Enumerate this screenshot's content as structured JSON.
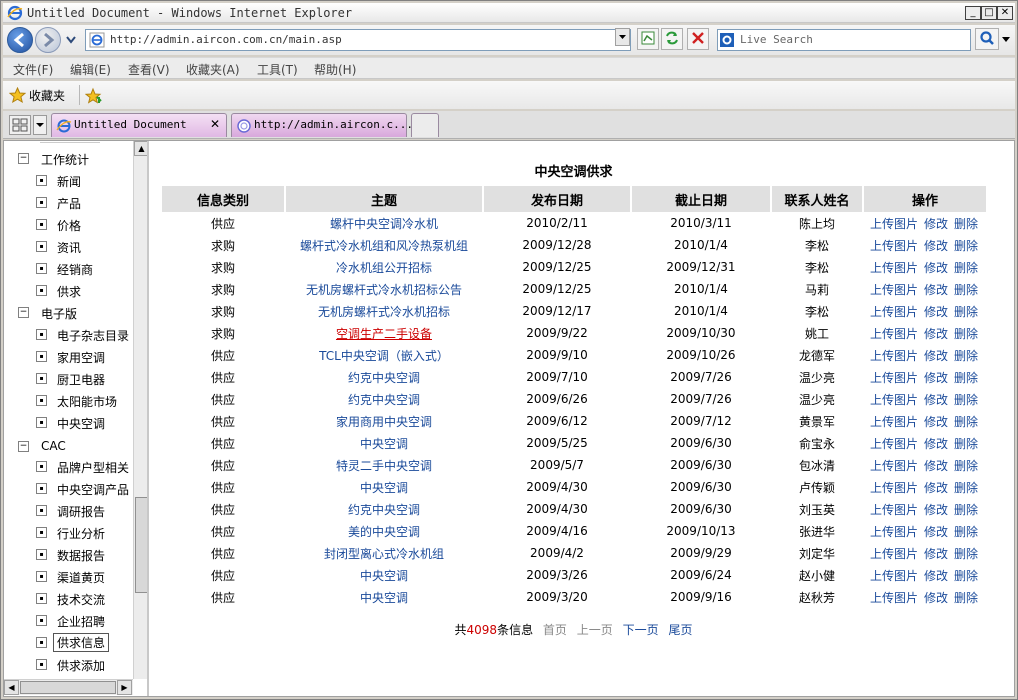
{
  "window": {
    "title": "Untitled Document - Windows Internet Explorer",
    "minimize": "_",
    "maximize": "□",
    "close": "✕"
  },
  "address": {
    "url": "http://admin.aircon.com.cn/main.asp",
    "search_placeholder": "Live Search"
  },
  "menu": [
    "文件(F)",
    "编辑(E)",
    "查看(V)",
    "收藏夹(A)",
    "工具(T)",
    "帮助(H)"
  ],
  "favorites": {
    "label": "收藏夹"
  },
  "tabs": [
    {
      "label": "Untitled Document",
      "close": "✕"
    },
    {
      "label": "http://admin.aircon.c..."
    }
  ],
  "sidebar": {
    "groups": [
      {
        "label": "工作统计",
        "expander": "−",
        "items": [
          "新闻",
          "产品",
          "价格",
          "资讯",
          "经销商",
          "供求"
        ]
      },
      {
        "label": "电子版",
        "expander": "−",
        "items": [
          "电子杂志目录",
          "家用空调",
          "厨卫电器",
          "太阳能市场",
          "中央空调"
        ]
      },
      {
        "label": "CAC",
        "expander": "−",
        "items": [
          "品牌户型相关",
          "中央空调产品",
          "调研报告",
          "行业分析",
          "数据报告",
          "渠道黄页",
          "技术交流",
          "企业招聘",
          "供求信息",
          "供求添加"
        ]
      }
    ],
    "selected": "供求信息"
  },
  "main": {
    "title": "中央空调供求",
    "headers": [
      "信息类别",
      "主题",
      "发布日期",
      "截止日期",
      "联系人姓名",
      "操作"
    ],
    "actions": [
      "上传图片",
      "修改",
      "删除"
    ],
    "rows": [
      {
        "type": "供应",
        "subject": "螺杆中央空调冷水机",
        "pub": "2010/2/11",
        "end": "2010/3/11",
        "contact": "陈上均"
      },
      {
        "type": "求购",
        "subject": "螺杆式冷水机组和风冷热泵机组",
        "pub": "2009/12/28",
        "end": "2010/1/4",
        "contact": "李松"
      },
      {
        "type": "求购",
        "subject": "冷水机组公开招标",
        "pub": "2009/12/25",
        "end": "2009/12/31",
        "contact": "李松"
      },
      {
        "type": "求购",
        "subject": "无机房螺杆式冷水机招标公告",
        "pub": "2009/12/25",
        "end": "2010/1/4",
        "contact": "马莉"
      },
      {
        "type": "求购",
        "subject": "无机房螺杆式冷水机招标",
        "pub": "2009/12/17",
        "end": "2010/1/4",
        "contact": "李松"
      },
      {
        "type": "求购",
        "subject": "空调生产二手设备",
        "pub": "2009/9/22",
        "end": "2009/10/30",
        "contact": "姚工"
      },
      {
        "type": "供应",
        "subject": "TCL中央空调（嵌入式）",
        "pub": "2009/9/10",
        "end": "2009/10/26",
        "contact": "龙德军"
      },
      {
        "type": "供应",
        "subject": "约克中央空调",
        "pub": "2009/7/10",
        "end": "2009/7/26",
        "contact": "温少亮"
      },
      {
        "type": "供应",
        "subject": "约克中央空调",
        "pub": "2009/6/26",
        "end": "2009/7/26",
        "contact": "温少亮"
      },
      {
        "type": "供应",
        "subject": "家用商用中央空调",
        "pub": "2009/6/12",
        "end": "2009/7/12",
        "contact": "黄景军"
      },
      {
        "type": "供应",
        "subject": "中央空调",
        "pub": "2009/5/25",
        "end": "2009/6/30",
        "contact": "俞宝永"
      },
      {
        "type": "供应",
        "subject": "特灵二手中央空调",
        "pub": "2009/5/7",
        "end": "2009/6/30",
        "contact": "包冰清"
      },
      {
        "type": "供应",
        "subject": "中央空调",
        "pub": "2009/4/30",
        "end": "2009/6/30",
        "contact": "卢传颖"
      },
      {
        "type": "供应",
        "subject": "约克中央空调",
        "pub": "2009/4/30",
        "end": "2009/6/30",
        "contact": "刘玉英"
      },
      {
        "type": "供应",
        "subject": "美的中央空调",
        "pub": "2009/4/16",
        "end": "2009/10/13",
        "contact": "张进华"
      },
      {
        "type": "供应",
        "subject": "封闭型离心式冷水机组",
        "pub": "2009/4/2",
        "end": "2009/9/29",
        "contact": "刘定华"
      },
      {
        "type": "供应",
        "subject": "中央空调",
        "pub": "2009/3/26",
        "end": "2009/6/24",
        "contact": "赵小健"
      },
      {
        "type": "供应",
        "subject": "中央空调",
        "pub": "2009/3/20",
        "end": "2009/9/16",
        "contact": "赵秋芳"
      }
    ],
    "highlighted_row": 5
  },
  "pager": {
    "prefix": "共",
    "count": "4098",
    "suffix": "条信息",
    "first": "首页",
    "prev": "上一页",
    "next": "下一页",
    "last": "尾页"
  }
}
